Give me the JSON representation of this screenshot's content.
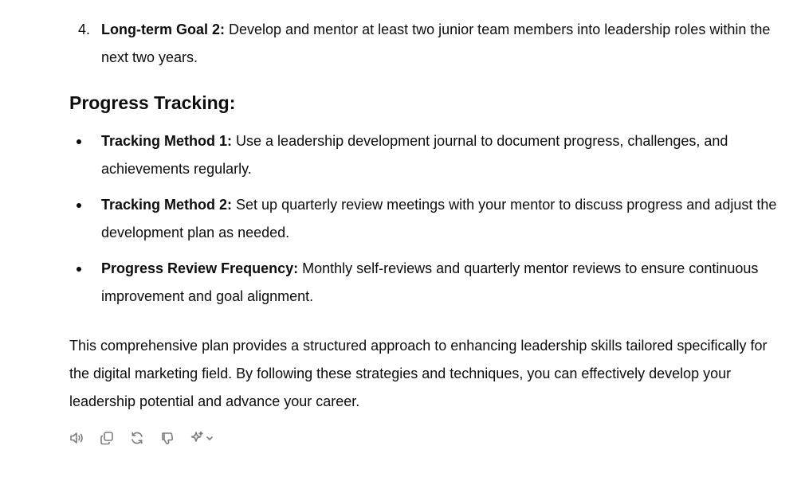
{
  "ordered_item": {
    "number": "4.",
    "label": "Long-term Goal 2:",
    "text": " Develop and mentor at least two junior team members into leadership roles within the next two years."
  },
  "section_heading": "Progress Tracking:",
  "bullets": [
    {
      "label": "Tracking Method 1:",
      "text": " Use a leadership development journal to document progress, challenges, and achievements regularly."
    },
    {
      "label": "Tracking Method 2:",
      "text": " Set up quarterly review meetings with your mentor to discuss progress and adjust the development plan as needed."
    },
    {
      "label": "Progress Review Frequency:",
      "text": " Monthly self-reviews and quarterly mentor reviews to ensure continuous improvement and goal alignment."
    }
  ],
  "closing_paragraph": "This comprehensive plan provides a structured approach to enhancing leadership skills tailored specifically for the digital marketing field. By following these strategies and techniques, you can effectively develop your leadership potential and advance your career.",
  "actions": [
    {
      "icon": "speaker-icon"
    },
    {
      "icon": "copy-icon"
    },
    {
      "icon": "regenerate-icon"
    },
    {
      "icon": "thumbs-down-icon"
    },
    {
      "icon": "sparkle-model-icon"
    }
  ],
  "colors": {
    "text": "#0d0d0d",
    "icon": "#7d7d7d",
    "background": "#ffffff"
  }
}
